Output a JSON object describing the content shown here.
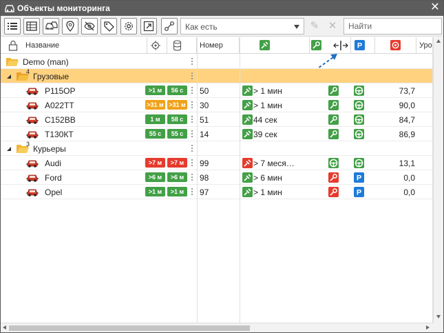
{
  "window": {
    "title": "Объекты мониторинга",
    "close_label": "✕"
  },
  "toolbar": {
    "dropdown_value": "Как есть",
    "search_placeholder": "Найти",
    "buttons": [
      "list-icon",
      "table-icon",
      "vehicles-icon",
      "geofence-icon",
      "hidden-icon",
      "tag-icon",
      "settings-icon",
      "export-icon",
      "share-icon"
    ]
  },
  "header": {
    "name": "Название",
    "number": "Номер",
    "level": "Уров"
  },
  "groups": [
    {
      "label": "Demo (man)"
    },
    {
      "label": "Грузовые",
      "count": "4"
    },
    {
      "label": "Курьеры",
      "count": "3"
    }
  ],
  "rows": [
    {
      "name": "Р115ОР",
      "b1": ">1 м",
      "b1c": "g",
      "b2": "56 с",
      "b2c": "g",
      "num": "50",
      "conn": "> 1 мин",
      "conn_color": "g",
      "ign": "key",
      "ign_color": "g",
      "move": "wheel",
      "move_color": "g",
      "val": "73,7"
    },
    {
      "name": "А022ТТ",
      "b1": ">31 м",
      "b1c": "o",
      "b2": ">31 м",
      "b2c": "o",
      "num": "30",
      "conn": "> 1 мин",
      "conn_color": "g",
      "ign": "key",
      "ign_color": "g",
      "move": "wheel",
      "move_color": "g",
      "val": "90,0"
    },
    {
      "name": "С152ВВ",
      "b1": "1 м",
      "b1c": "g",
      "b2": "58 с",
      "b2c": "g",
      "num": "51",
      "conn": "44 сек",
      "conn_color": "g",
      "ign": "key",
      "ign_color": "g",
      "move": "wheel",
      "move_color": "g",
      "val": "84,7"
    },
    {
      "name": "Т130КТ",
      "b1": "55 с",
      "b1c": "g",
      "b2": "55 с",
      "b2c": "g",
      "num": "14",
      "conn": "39 сек",
      "conn_color": "g",
      "ign": "key",
      "ign_color": "g",
      "move": "wheel",
      "move_color": "g",
      "val": "86,9"
    },
    {
      "name": "Audi",
      "b1": ">7 м",
      "b1c": "r",
      "b2": ">7 м",
      "b2c": "r",
      "num": "99",
      "conn": "> 7 меся…",
      "conn_color": "r",
      "ign": "wheel",
      "ign_color": "g",
      "move": "wheel",
      "move_color": "g",
      "val": "13,1"
    },
    {
      "name": "Ford",
      "b1": ">6 м",
      "b1c": "g",
      "b2": ">6 м",
      "b2c": "g",
      "num": "98",
      "conn": "> 6 мин",
      "conn_color": "g",
      "ign": "key",
      "ign_color": "r",
      "move": "P",
      "move_color": "b",
      "val": "0,0"
    },
    {
      "name": "Opel",
      "b1": ">1 м",
      "b1c": "g",
      "b2": ">1 м",
      "b2c": "g",
      "num": "97",
      "conn": "> 1 мин",
      "conn_color": "g",
      "ign": "key",
      "ign_color": "r",
      "move": "P",
      "move_color": "b",
      "val": "0,0"
    }
  ],
  "colors": {
    "green": "#43a047",
    "orange": "#f0a21b",
    "red": "#e53b2d",
    "blue": "#1e7bd8",
    "selected": "#ffd27f"
  }
}
